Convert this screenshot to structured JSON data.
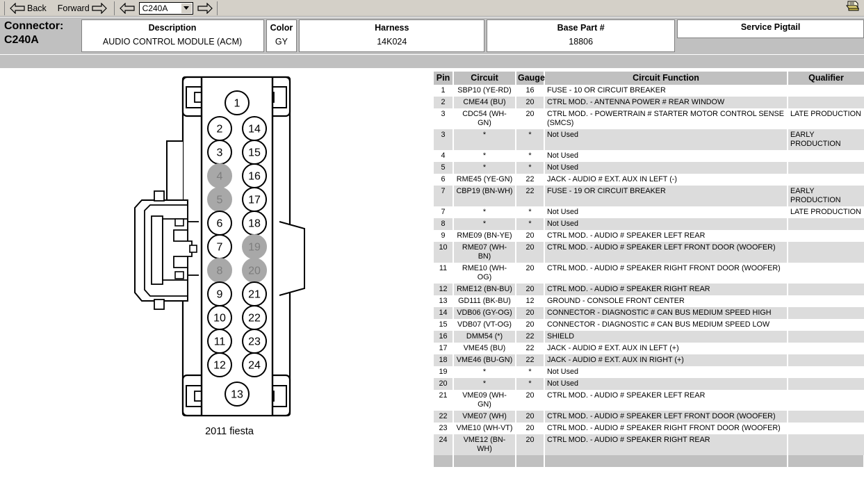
{
  "toolbar": {
    "back_label": "Back",
    "forward_label": "Forward",
    "connector_select_value": "C240A",
    "prev_icon": "left-arrow-icon",
    "next_icon": "right-arrow-icon",
    "print_icon": "printer-icon"
  },
  "connector_header": {
    "title_label": "Connector:",
    "title_value": "C240A",
    "fields": [
      {
        "label": "Description",
        "value": "AUDIO CONTROL MODULE (ACM)"
      },
      {
        "label": "Color",
        "value": "GY"
      },
      {
        "label": "Harness",
        "value": "14K024"
      },
      {
        "label": "Base Part #",
        "value": "18806"
      },
      {
        "label": "Service Pigtail",
        "value": ""
      }
    ]
  },
  "diagram": {
    "caption": "2011 fiesta",
    "left_column_pins": [
      "1",
      "2",
      "3",
      "4",
      "5",
      "6",
      "7",
      "8",
      "9",
      "10",
      "11",
      "12",
      "13"
    ],
    "right_column_pins": [
      "14",
      "15",
      "16",
      "17",
      "18",
      "19",
      "20",
      "21",
      "22",
      "23",
      "24"
    ],
    "unused_pins": [
      "4",
      "5",
      "8",
      "19",
      "20"
    ],
    "unused_fill": "#a8a8a8",
    "used_fill": "#ffffff"
  },
  "table": {
    "columns": [
      "Pin",
      "Circuit",
      "Gauge",
      "Circuit Function",
      "Qualifier"
    ],
    "rows": [
      {
        "pin": "1",
        "circuit": "SBP10 (YE-RD)",
        "gauge": "16",
        "function": "FUSE - 10 OR CIRCUIT BREAKER",
        "qualifier": "",
        "shade": false
      },
      {
        "pin": "2",
        "circuit": "CME44 (BU)",
        "gauge": "20",
        "function": "CTRL MOD. - ANTENNA POWER # REAR WINDOW",
        "qualifier": "",
        "shade": true
      },
      {
        "pin": "3",
        "circuit": "CDC54 (WH-GN)",
        "gauge": "20",
        "function": "CTRL MOD. - POWERTRAIN # STARTER MOTOR CONTROL SENSE (SMCS)",
        "qualifier": "LATE PRODUCTION",
        "shade": false
      },
      {
        "pin": "3",
        "circuit": "*",
        "gauge": "*",
        "function": "Not Used",
        "qualifier": "EARLY PRODUCTION",
        "shade": true
      },
      {
        "pin": "4",
        "circuit": "*",
        "gauge": "*",
        "function": "Not Used",
        "qualifier": "",
        "shade": false
      },
      {
        "pin": "5",
        "circuit": "*",
        "gauge": "*",
        "function": "Not Used",
        "qualifier": "",
        "shade": true
      },
      {
        "pin": "6",
        "circuit": "RME45 (YE-GN)",
        "gauge": "22",
        "function": "JACK - AUDIO # EXT. AUX IN LEFT (-)",
        "qualifier": "",
        "shade": false
      },
      {
        "pin": "7",
        "circuit": "CBP19 (BN-WH)",
        "gauge": "22",
        "function": "FUSE - 19 OR CIRCUIT BREAKER",
        "qualifier": "EARLY PRODUCTION",
        "shade": true
      },
      {
        "pin": "7",
        "circuit": "*",
        "gauge": "*",
        "function": "Not Used",
        "qualifier": "LATE PRODUCTION",
        "shade": false
      },
      {
        "pin": "8",
        "circuit": "*",
        "gauge": "*",
        "function": "Not Used",
        "qualifier": "",
        "shade": true
      },
      {
        "pin": "9",
        "circuit": "RME09 (BN-YE)",
        "gauge": "20",
        "function": "CTRL MOD. - AUDIO # SPEAKER LEFT REAR",
        "qualifier": "",
        "shade": false
      },
      {
        "pin": "10",
        "circuit": "RME07 (WH-BN)",
        "gauge": "20",
        "function": "CTRL MOD. - AUDIO # SPEAKER LEFT FRONT DOOR (WOOFER)",
        "qualifier": "",
        "shade": true
      },
      {
        "pin": "11",
        "circuit": "RME10 (WH-OG)",
        "gauge": "20",
        "function": "CTRL MOD. - AUDIO # SPEAKER RIGHT FRONT DOOR (WOOFER)",
        "qualifier": "",
        "shade": false
      },
      {
        "pin": "12",
        "circuit": "RME12 (BN-BU)",
        "gauge": "20",
        "function": "CTRL MOD. - AUDIO # SPEAKER RIGHT REAR",
        "qualifier": "",
        "shade": true
      },
      {
        "pin": "13",
        "circuit": "GD111 (BK-BU)",
        "gauge": "12",
        "function": "GROUND - CONSOLE FRONT CENTER",
        "qualifier": "",
        "shade": false
      },
      {
        "pin": "14",
        "circuit": "VDB06 (GY-OG)",
        "gauge": "20",
        "function": "CONNECTOR - DIAGNOSTIC # CAN BUS MEDIUM SPEED HIGH",
        "qualifier": "",
        "shade": true
      },
      {
        "pin": "15",
        "circuit": "VDB07 (VT-OG)",
        "gauge": "20",
        "function": "CONNECTOR - DIAGNOSTIC # CAN BUS MEDIUM SPEED LOW",
        "qualifier": "",
        "shade": false
      },
      {
        "pin": "16",
        "circuit": "DMM54 (*)",
        "gauge": "22",
        "function": "SHIELD",
        "qualifier": "",
        "shade": true
      },
      {
        "pin": "17",
        "circuit": "VME45 (BU)",
        "gauge": "22",
        "function": "JACK - AUDIO # EXT. AUX IN LEFT (+)",
        "qualifier": "",
        "shade": false
      },
      {
        "pin": "18",
        "circuit": "VME46 (BU-GN)",
        "gauge": "22",
        "function": "JACK - AUDIO # EXT. AUX IN RIGHT (+)",
        "qualifier": "",
        "shade": true
      },
      {
        "pin": "19",
        "circuit": "*",
        "gauge": "*",
        "function": "Not Used",
        "qualifier": "",
        "shade": false
      },
      {
        "pin": "20",
        "circuit": "*",
        "gauge": "*",
        "function": "Not Used",
        "qualifier": "",
        "shade": true
      },
      {
        "pin": "21",
        "circuit": "VME09 (WH-GN)",
        "gauge": "20",
        "function": "CTRL MOD. - AUDIO # SPEAKER LEFT REAR",
        "qualifier": "",
        "shade": false
      },
      {
        "pin": "22",
        "circuit": "VME07 (WH)",
        "gauge": "20",
        "function": "CTRL MOD. - AUDIO # SPEAKER LEFT FRONT DOOR (WOOFER)",
        "qualifier": "",
        "shade": true
      },
      {
        "pin": "23",
        "circuit": "VME10 (WH-VT)",
        "gauge": "20",
        "function": "CTRL MOD. - AUDIO # SPEAKER RIGHT FRONT DOOR (WOOFER)",
        "qualifier": "",
        "shade": false
      },
      {
        "pin": "24",
        "circuit": "VME12 (BN-WH)",
        "gauge": "20",
        "function": "CTRL MOD. - AUDIO # SPEAKER RIGHT REAR",
        "qualifier": "",
        "shade": true
      }
    ]
  }
}
